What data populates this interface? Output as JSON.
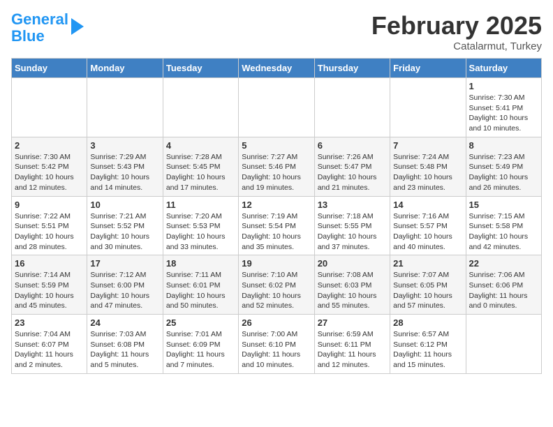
{
  "header": {
    "logo_line1": "General",
    "logo_line2": "Blue",
    "month": "February 2025",
    "location": "Catalarmut, Turkey"
  },
  "days_of_week": [
    "Sunday",
    "Monday",
    "Tuesday",
    "Wednesday",
    "Thursday",
    "Friday",
    "Saturday"
  ],
  "weeks": [
    [
      {
        "day": "",
        "info": ""
      },
      {
        "day": "",
        "info": ""
      },
      {
        "day": "",
        "info": ""
      },
      {
        "day": "",
        "info": ""
      },
      {
        "day": "",
        "info": ""
      },
      {
        "day": "",
        "info": ""
      },
      {
        "day": "1",
        "info": "Sunrise: 7:30 AM\nSunset: 5:41 PM\nDaylight: 10 hours\nand 10 minutes."
      }
    ],
    [
      {
        "day": "2",
        "info": "Sunrise: 7:30 AM\nSunset: 5:42 PM\nDaylight: 10 hours\nand 12 minutes."
      },
      {
        "day": "3",
        "info": "Sunrise: 7:29 AM\nSunset: 5:43 PM\nDaylight: 10 hours\nand 14 minutes."
      },
      {
        "day": "4",
        "info": "Sunrise: 7:28 AM\nSunset: 5:45 PM\nDaylight: 10 hours\nand 17 minutes."
      },
      {
        "day": "5",
        "info": "Sunrise: 7:27 AM\nSunset: 5:46 PM\nDaylight: 10 hours\nand 19 minutes."
      },
      {
        "day": "6",
        "info": "Sunrise: 7:26 AM\nSunset: 5:47 PM\nDaylight: 10 hours\nand 21 minutes."
      },
      {
        "day": "7",
        "info": "Sunrise: 7:24 AM\nSunset: 5:48 PM\nDaylight: 10 hours\nand 23 minutes."
      },
      {
        "day": "8",
        "info": "Sunrise: 7:23 AM\nSunset: 5:49 PM\nDaylight: 10 hours\nand 26 minutes."
      }
    ],
    [
      {
        "day": "9",
        "info": "Sunrise: 7:22 AM\nSunset: 5:51 PM\nDaylight: 10 hours\nand 28 minutes."
      },
      {
        "day": "10",
        "info": "Sunrise: 7:21 AM\nSunset: 5:52 PM\nDaylight: 10 hours\nand 30 minutes."
      },
      {
        "day": "11",
        "info": "Sunrise: 7:20 AM\nSunset: 5:53 PM\nDaylight: 10 hours\nand 33 minutes."
      },
      {
        "day": "12",
        "info": "Sunrise: 7:19 AM\nSunset: 5:54 PM\nDaylight: 10 hours\nand 35 minutes."
      },
      {
        "day": "13",
        "info": "Sunrise: 7:18 AM\nSunset: 5:55 PM\nDaylight: 10 hours\nand 37 minutes."
      },
      {
        "day": "14",
        "info": "Sunrise: 7:16 AM\nSunset: 5:57 PM\nDaylight: 10 hours\nand 40 minutes."
      },
      {
        "day": "15",
        "info": "Sunrise: 7:15 AM\nSunset: 5:58 PM\nDaylight: 10 hours\nand 42 minutes."
      }
    ],
    [
      {
        "day": "16",
        "info": "Sunrise: 7:14 AM\nSunset: 5:59 PM\nDaylight: 10 hours\nand 45 minutes."
      },
      {
        "day": "17",
        "info": "Sunrise: 7:12 AM\nSunset: 6:00 PM\nDaylight: 10 hours\nand 47 minutes."
      },
      {
        "day": "18",
        "info": "Sunrise: 7:11 AM\nSunset: 6:01 PM\nDaylight: 10 hours\nand 50 minutes."
      },
      {
        "day": "19",
        "info": "Sunrise: 7:10 AM\nSunset: 6:02 PM\nDaylight: 10 hours\nand 52 minutes."
      },
      {
        "day": "20",
        "info": "Sunrise: 7:08 AM\nSunset: 6:03 PM\nDaylight: 10 hours\nand 55 minutes."
      },
      {
        "day": "21",
        "info": "Sunrise: 7:07 AM\nSunset: 6:05 PM\nDaylight: 10 hours\nand 57 minutes."
      },
      {
        "day": "22",
        "info": "Sunrise: 7:06 AM\nSunset: 6:06 PM\nDaylight: 11 hours\nand 0 minutes."
      }
    ],
    [
      {
        "day": "23",
        "info": "Sunrise: 7:04 AM\nSunset: 6:07 PM\nDaylight: 11 hours\nand 2 minutes."
      },
      {
        "day": "24",
        "info": "Sunrise: 7:03 AM\nSunset: 6:08 PM\nDaylight: 11 hours\nand 5 minutes."
      },
      {
        "day": "25",
        "info": "Sunrise: 7:01 AM\nSunset: 6:09 PM\nDaylight: 11 hours\nand 7 minutes."
      },
      {
        "day": "26",
        "info": "Sunrise: 7:00 AM\nSunset: 6:10 PM\nDaylight: 11 hours\nand 10 minutes."
      },
      {
        "day": "27",
        "info": "Sunrise: 6:59 AM\nSunset: 6:11 PM\nDaylight: 11 hours\nand 12 minutes."
      },
      {
        "day": "28",
        "info": "Sunrise: 6:57 AM\nSunset: 6:12 PM\nDaylight: 11 hours\nand 15 minutes."
      },
      {
        "day": "",
        "info": ""
      }
    ]
  ]
}
